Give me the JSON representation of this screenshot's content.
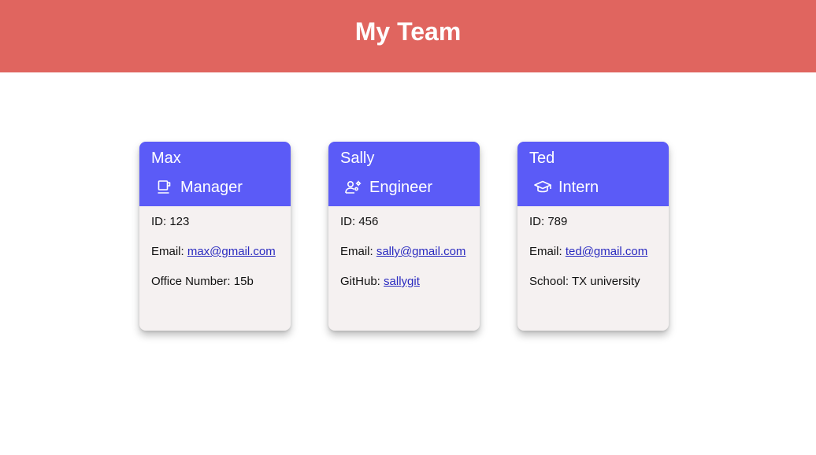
{
  "header": {
    "title": "My Team"
  },
  "team": [
    {
      "name": "Max",
      "role": "Manager",
      "role_icon": "coffee-cup-icon",
      "id_label": "ID: ",
      "id": "123",
      "email_label": "Email: ",
      "email": "max@gmail.com",
      "extra_label": "Office Number: ",
      "extra_value": "15b"
    },
    {
      "name": "Sally",
      "role": "Engineer",
      "role_icon": "user-gear-icon",
      "id_label": "ID: ",
      "id": "456",
      "email_label": "Email: ",
      "email": "sally@gmail.com",
      "extra_label": "GitHub: ",
      "extra_value": "sallygit"
    },
    {
      "name": "Ted",
      "role": "Intern",
      "role_icon": "graduation-cap-icon",
      "id_label": "ID: ",
      "id": "789",
      "email_label": "Email: ",
      "email": "ted@gmail.com",
      "extra_label": "School: ",
      "extra_value": "TX university"
    }
  ],
  "colors": {
    "header_bg": "#e0655f",
    "card_head_bg": "#5b5bf7",
    "card_body_bg": "#f5f1f1",
    "link": "#2a2ac0"
  }
}
